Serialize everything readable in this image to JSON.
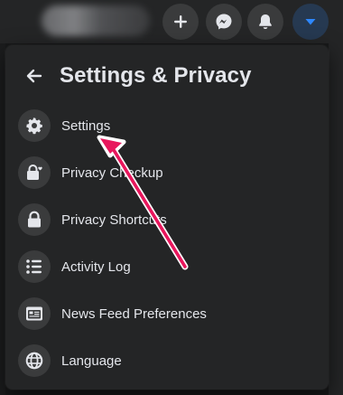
{
  "header": {
    "buttons": [
      {
        "icon": "plus-icon"
      },
      {
        "icon": "messenger-icon"
      },
      {
        "icon": "bell-icon"
      },
      {
        "icon": "caret-down-icon",
        "active": true
      }
    ]
  },
  "panel": {
    "title": "Settings & Privacy",
    "back_icon": "arrow-left-icon",
    "items": [
      {
        "label": "Settings",
        "icon": "gear-icon"
      },
      {
        "label": "Privacy Checkup",
        "icon": "lock-heart-icon"
      },
      {
        "label": "Privacy Shortcuts",
        "icon": "lock-icon"
      },
      {
        "label": "Activity Log",
        "icon": "list-icon"
      },
      {
        "label": "News Feed Preferences",
        "icon": "feed-icon"
      },
      {
        "label": "Language",
        "icon": "globe-icon"
      }
    ]
  },
  "colors": {
    "accent": "#2d88ff",
    "annotation_arrow": "#e8175d",
    "panel_bg": "#242526",
    "icon_bg": "#3a3b3c"
  }
}
